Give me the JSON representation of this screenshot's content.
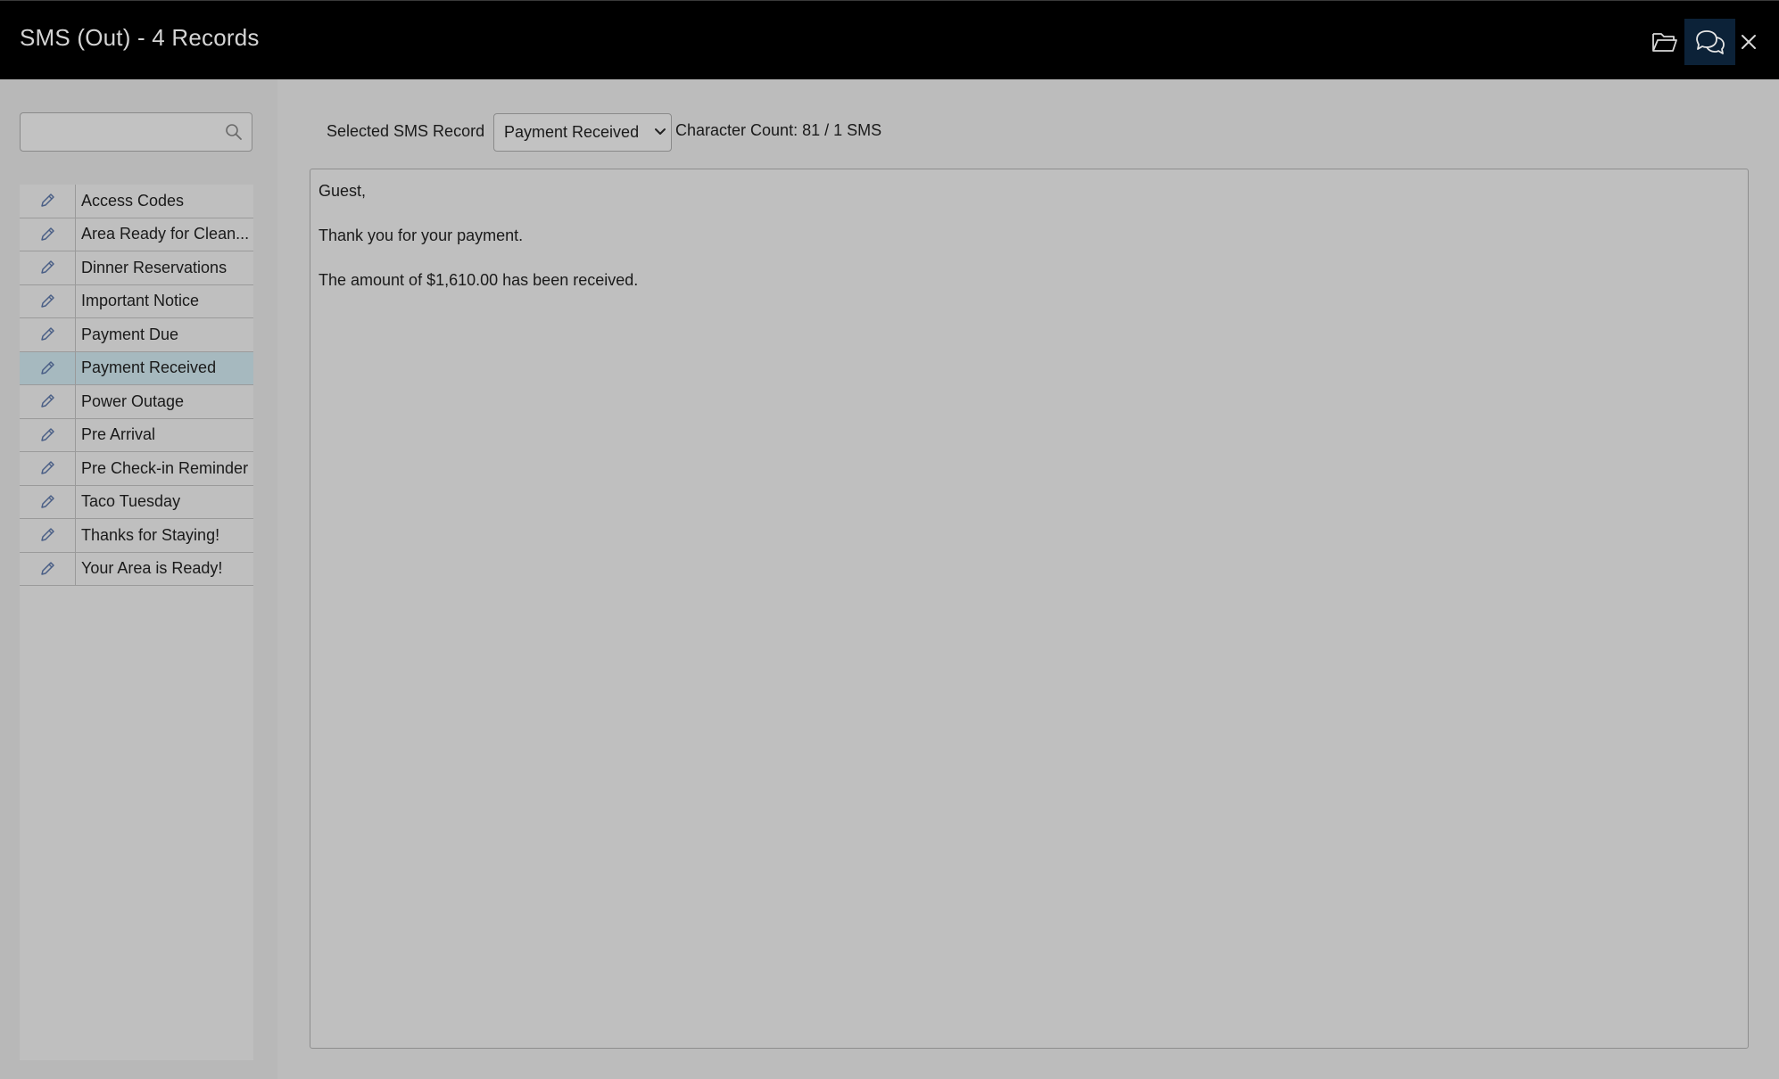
{
  "window": {
    "title": "SMS (Out) - 4 Records"
  },
  "toolbar": {
    "icons": [
      "folder-open-icon",
      "chat-bubbles-icon",
      "close-icon"
    ]
  },
  "sidebar": {
    "search": {
      "value": "",
      "placeholder": ""
    },
    "items": [
      {
        "label": "Access Codes",
        "selected": false
      },
      {
        "label": "Area Ready for Clean...",
        "selected": false
      },
      {
        "label": "Dinner Reservations",
        "selected": false
      },
      {
        "label": "Important Notice",
        "selected": false
      },
      {
        "label": "Payment Due",
        "selected": false
      },
      {
        "label": "Payment Received",
        "selected": true
      },
      {
        "label": "Power Outage",
        "selected": false
      },
      {
        "label": "Pre Arrival",
        "selected": false
      },
      {
        "label": "Pre Check-in Reminder",
        "selected": false
      },
      {
        "label": "Taco Tuesday",
        "selected": false
      },
      {
        "label": "Thanks for Staying!",
        "selected": false
      },
      {
        "label": "Your Area is Ready!",
        "selected": false
      }
    ]
  },
  "main": {
    "selected_label": "Selected SMS Record",
    "selected_value": "Payment Received",
    "character_count": "Character Count: 81 / 1 SMS",
    "message": {
      "line1": "Guest,",
      "line2": "Thank you for your payment.",
      "line3": "The amount of $1,610.00 has been received."
    }
  },
  "colors": {
    "titlebar": "#000000",
    "active_button": "#0c2238",
    "selected_row": "#a6b9bf",
    "pencil_icon": "#4a5f86"
  }
}
